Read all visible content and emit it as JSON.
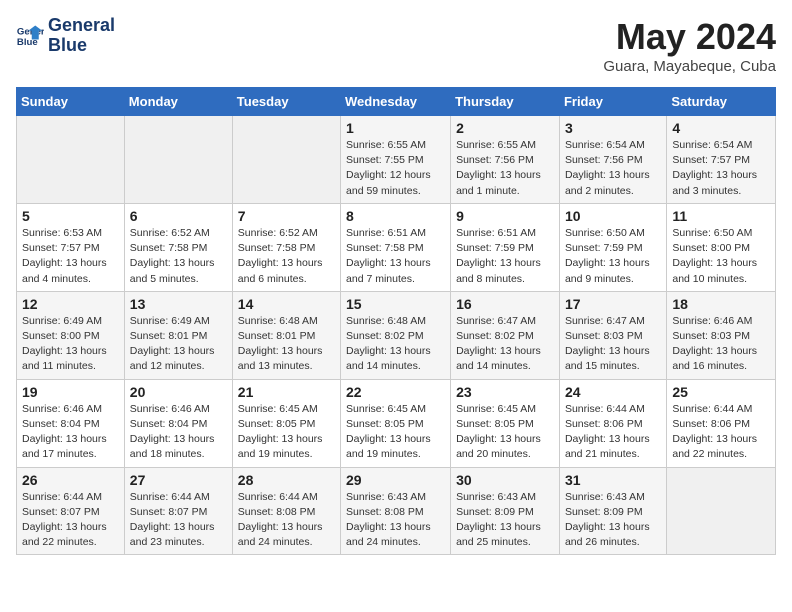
{
  "header": {
    "logo_line1": "General",
    "logo_line2": "Blue",
    "month": "May 2024",
    "location": "Guara, Mayabeque, Cuba"
  },
  "days_of_week": [
    "Sunday",
    "Monday",
    "Tuesday",
    "Wednesday",
    "Thursday",
    "Friday",
    "Saturday"
  ],
  "weeks": [
    [
      {
        "num": "",
        "info": ""
      },
      {
        "num": "",
        "info": ""
      },
      {
        "num": "",
        "info": ""
      },
      {
        "num": "1",
        "info": "Sunrise: 6:55 AM\nSunset: 7:55 PM\nDaylight: 12 hours\nand 59 minutes."
      },
      {
        "num": "2",
        "info": "Sunrise: 6:55 AM\nSunset: 7:56 PM\nDaylight: 13 hours\nand 1 minute."
      },
      {
        "num": "3",
        "info": "Sunrise: 6:54 AM\nSunset: 7:56 PM\nDaylight: 13 hours\nand 2 minutes."
      },
      {
        "num": "4",
        "info": "Sunrise: 6:54 AM\nSunset: 7:57 PM\nDaylight: 13 hours\nand 3 minutes."
      }
    ],
    [
      {
        "num": "5",
        "info": "Sunrise: 6:53 AM\nSunset: 7:57 PM\nDaylight: 13 hours\nand 4 minutes."
      },
      {
        "num": "6",
        "info": "Sunrise: 6:52 AM\nSunset: 7:58 PM\nDaylight: 13 hours\nand 5 minutes."
      },
      {
        "num": "7",
        "info": "Sunrise: 6:52 AM\nSunset: 7:58 PM\nDaylight: 13 hours\nand 6 minutes."
      },
      {
        "num": "8",
        "info": "Sunrise: 6:51 AM\nSunset: 7:58 PM\nDaylight: 13 hours\nand 7 minutes."
      },
      {
        "num": "9",
        "info": "Sunrise: 6:51 AM\nSunset: 7:59 PM\nDaylight: 13 hours\nand 8 minutes."
      },
      {
        "num": "10",
        "info": "Sunrise: 6:50 AM\nSunset: 7:59 PM\nDaylight: 13 hours\nand 9 minutes."
      },
      {
        "num": "11",
        "info": "Sunrise: 6:50 AM\nSunset: 8:00 PM\nDaylight: 13 hours\nand 10 minutes."
      }
    ],
    [
      {
        "num": "12",
        "info": "Sunrise: 6:49 AM\nSunset: 8:00 PM\nDaylight: 13 hours\nand 11 minutes."
      },
      {
        "num": "13",
        "info": "Sunrise: 6:49 AM\nSunset: 8:01 PM\nDaylight: 13 hours\nand 12 minutes."
      },
      {
        "num": "14",
        "info": "Sunrise: 6:48 AM\nSunset: 8:01 PM\nDaylight: 13 hours\nand 13 minutes."
      },
      {
        "num": "15",
        "info": "Sunrise: 6:48 AM\nSunset: 8:02 PM\nDaylight: 13 hours\nand 14 minutes."
      },
      {
        "num": "16",
        "info": "Sunrise: 6:47 AM\nSunset: 8:02 PM\nDaylight: 13 hours\nand 14 minutes."
      },
      {
        "num": "17",
        "info": "Sunrise: 6:47 AM\nSunset: 8:03 PM\nDaylight: 13 hours\nand 15 minutes."
      },
      {
        "num": "18",
        "info": "Sunrise: 6:46 AM\nSunset: 8:03 PM\nDaylight: 13 hours\nand 16 minutes."
      }
    ],
    [
      {
        "num": "19",
        "info": "Sunrise: 6:46 AM\nSunset: 8:04 PM\nDaylight: 13 hours\nand 17 minutes."
      },
      {
        "num": "20",
        "info": "Sunrise: 6:46 AM\nSunset: 8:04 PM\nDaylight: 13 hours\nand 18 minutes."
      },
      {
        "num": "21",
        "info": "Sunrise: 6:45 AM\nSunset: 8:05 PM\nDaylight: 13 hours\nand 19 minutes."
      },
      {
        "num": "22",
        "info": "Sunrise: 6:45 AM\nSunset: 8:05 PM\nDaylight: 13 hours\nand 19 minutes."
      },
      {
        "num": "23",
        "info": "Sunrise: 6:45 AM\nSunset: 8:05 PM\nDaylight: 13 hours\nand 20 minutes."
      },
      {
        "num": "24",
        "info": "Sunrise: 6:44 AM\nSunset: 8:06 PM\nDaylight: 13 hours\nand 21 minutes."
      },
      {
        "num": "25",
        "info": "Sunrise: 6:44 AM\nSunset: 8:06 PM\nDaylight: 13 hours\nand 22 minutes."
      }
    ],
    [
      {
        "num": "26",
        "info": "Sunrise: 6:44 AM\nSunset: 8:07 PM\nDaylight: 13 hours\nand 22 minutes."
      },
      {
        "num": "27",
        "info": "Sunrise: 6:44 AM\nSunset: 8:07 PM\nDaylight: 13 hours\nand 23 minutes."
      },
      {
        "num": "28",
        "info": "Sunrise: 6:44 AM\nSunset: 8:08 PM\nDaylight: 13 hours\nand 24 minutes."
      },
      {
        "num": "29",
        "info": "Sunrise: 6:43 AM\nSunset: 8:08 PM\nDaylight: 13 hours\nand 24 minutes."
      },
      {
        "num": "30",
        "info": "Sunrise: 6:43 AM\nSunset: 8:09 PM\nDaylight: 13 hours\nand 25 minutes."
      },
      {
        "num": "31",
        "info": "Sunrise: 6:43 AM\nSunset: 8:09 PM\nDaylight: 13 hours\nand 26 minutes."
      },
      {
        "num": "",
        "info": ""
      }
    ]
  ]
}
